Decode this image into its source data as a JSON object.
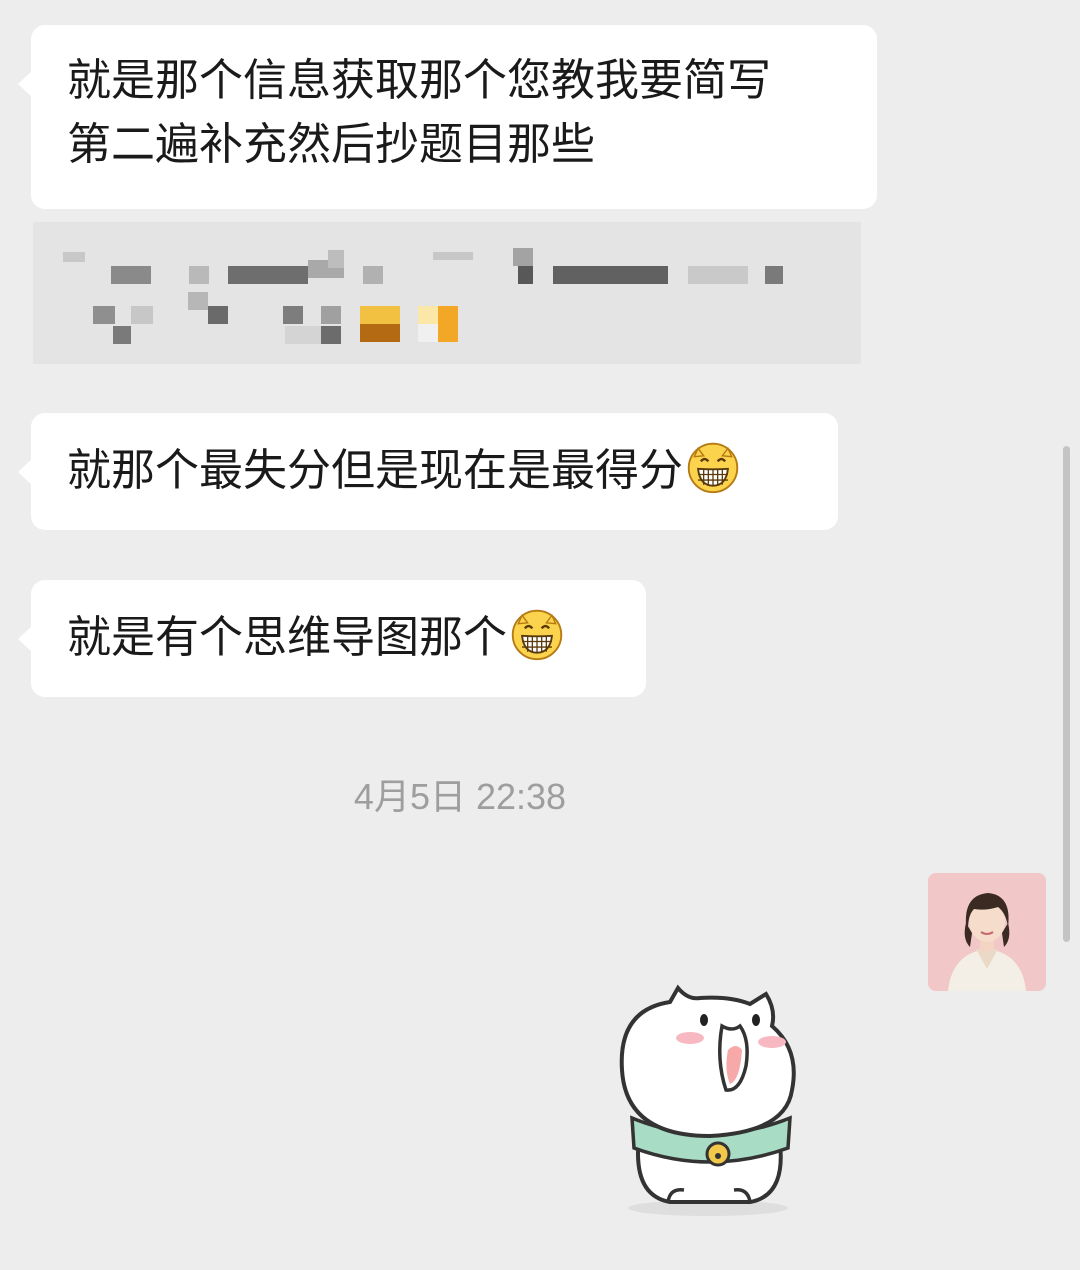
{
  "messages": [
    {
      "lines": [
        "就是那个信息获取那个您教我要简写",
        "第二遍补充然后抄题目那些"
      ]
    },
    {
      "text": "就那个最失分但是现在是最得分",
      "emoji": "grinning-face-emoji"
    },
    {
      "text": "就是有个思维导图那个",
      "emoji": "grinning-face-emoji"
    }
  ],
  "timestamp": "4月5日 22:38",
  "icons": {
    "avatar": "user-avatar-photo",
    "sticker": "cute-white-cat-sticker"
  },
  "colors": {
    "background": "#ededed",
    "bubble": "#ffffff",
    "text": "#1a1a1a",
    "timestamp": "#9e9e9e"
  }
}
